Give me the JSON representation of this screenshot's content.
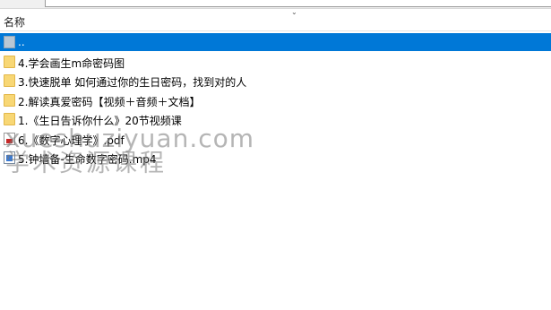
{
  "header": {
    "name_column": "名称"
  },
  "rows": [
    {
      "label": "..",
      "icon": "up-folder-icon",
      "selected": true
    },
    {
      "label": "4.学会画生m命密码图",
      "icon": "folder-icon"
    },
    {
      "label": "3.快速脱单 如何通过你的生日密码，找到对的人",
      "icon": "folder-icon"
    },
    {
      "label": "2.解读真爱密码【视频＋音频＋文档】",
      "icon": "folder-icon"
    },
    {
      "label": "1.《生日告诉你什么》20节视频课",
      "icon": "folder-icon"
    },
    {
      "label": "6.《数字心理学》.pdf",
      "icon": "pdf-file-icon"
    },
    {
      "label": "5.钟墙备-生命数字密码.mp4",
      "icon": "video-file-icon"
    }
  ],
  "watermark": {
    "line1": "xueshuziyuan.com",
    "line2": "学术资源课程"
  },
  "colors": {
    "selection": "#0078d7",
    "folder": "#f8d775"
  }
}
